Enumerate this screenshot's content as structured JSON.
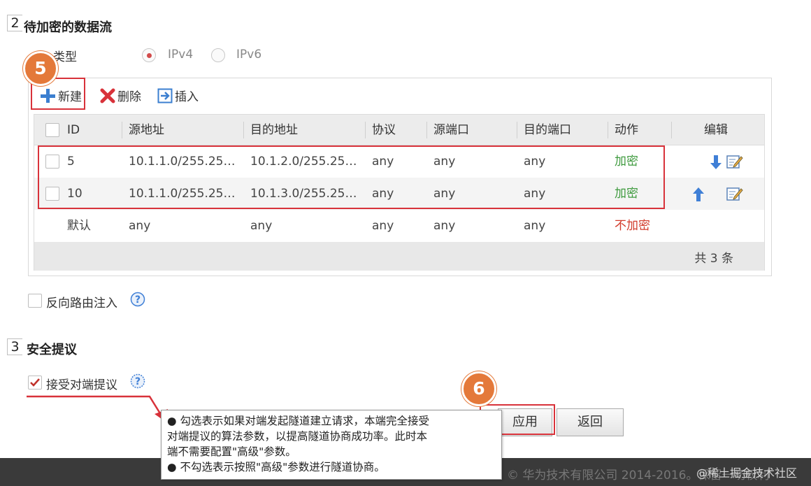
{
  "sections": {
    "s2": {
      "num": "2",
      "title": "待加密的数据流"
    },
    "s3": {
      "num": "3",
      "title": "安全提议"
    }
  },
  "type_row": {
    "label": "类型",
    "options": [
      "IPv4",
      "IPv6"
    ],
    "selected": "IPv4"
  },
  "toolbar": {
    "new_label": "新建",
    "delete_label": "删除",
    "insert_label": "插入"
  },
  "table": {
    "headers": [
      "ID",
      "源地址",
      "目的地址",
      "协议",
      "源端口",
      "目的端口",
      "动作",
      "编辑"
    ],
    "rows": [
      {
        "id": "5",
        "src": "10.1.1.0/255.25…",
        "dst": "10.1.2.0/255.25…",
        "proto": "any",
        "sport": "any",
        "dport": "any",
        "action": "加密"
      },
      {
        "id": "10",
        "src": "10.1.1.0/255.25…",
        "dst": "10.1.3.0/255.25…",
        "proto": "any",
        "sport": "any",
        "dport": "any",
        "action": "加密"
      },
      {
        "id": "默认",
        "src": "any",
        "dst": "any",
        "proto": "any",
        "sport": "any",
        "dport": "any",
        "action": "不加密"
      }
    ],
    "footer": "共 3 条"
  },
  "reverse_route": {
    "label": "反向路由注入",
    "checked": false
  },
  "accept_peer": {
    "label": "接受对端提议",
    "checked": true
  },
  "tooltip": {
    "line1": "● 勾选表示如果对端发起隧道建立请求，本端完全接受",
    "line2": "对端提议的算法参数，以提高隧道协商成功率。此时本",
    "line3": "端不需要配置\"高级\"参数。",
    "line4": "● 不勾选表示按照\"高级\"参数进行隧道协商。"
  },
  "buttons": {
    "apply": "应用",
    "back": "返回"
  },
  "badges": {
    "b5": "5",
    "b6": "6"
  },
  "footer": {
    "copyright": "© 华为技术有限公司 2014-2016。保留一切权利",
    "watermark": "@稀土掘金技术社区"
  },
  "colors": {
    "accent_red": "#d8323a",
    "badge_orange": "#e4793a",
    "green": "#3e9a3e"
  }
}
